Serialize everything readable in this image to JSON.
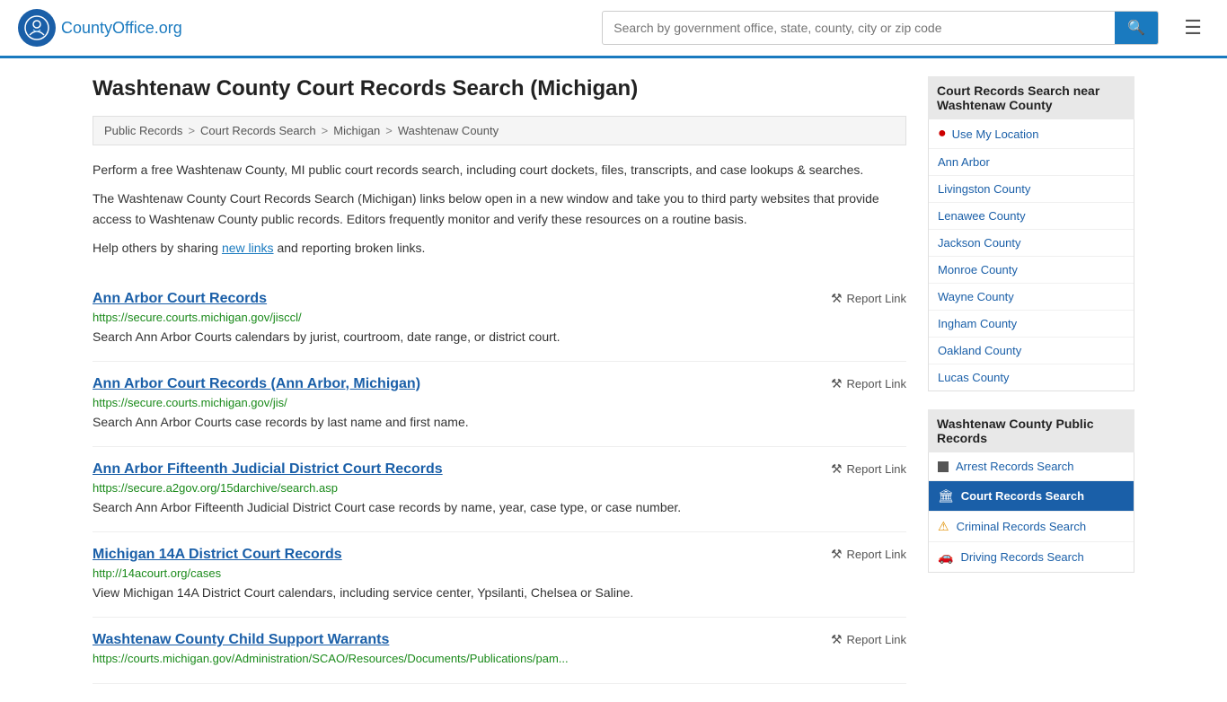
{
  "header": {
    "logo_text": "CountyOffice",
    "logo_suffix": ".org",
    "search_placeholder": "Search by government office, state, county, city or zip code",
    "search_icon": "🔍",
    "menu_icon": "☰"
  },
  "page": {
    "title": "Washtenaw County Court Records Search (Michigan)"
  },
  "breadcrumb": {
    "items": [
      {
        "label": "Public Records",
        "href": "#"
      },
      {
        "label": "Court Records Search",
        "href": "#"
      },
      {
        "label": "Michigan",
        "href": "#"
      },
      {
        "label": "Washtenaw County",
        "href": "#"
      }
    ]
  },
  "description": {
    "para1": "Perform a free Washtenaw County, MI public court records search, including court dockets, files, transcripts, and case lookups & searches.",
    "para2": "The Washtenaw County Court Records Search (Michigan) links below open in a new window and take you to third party websites that provide access to Washtenaw County public records. Editors frequently monitor and verify these resources on a routine basis.",
    "para3_before": "Help others by sharing ",
    "para3_link": "new links",
    "para3_after": " and reporting broken links."
  },
  "results": [
    {
      "title": "Ann Arbor Court Records",
      "url": "https://secure.courts.michigan.gov/jisccl/",
      "description": "Search Ann Arbor Courts calendars by jurist, courtroom, date range, or district court.",
      "report_label": "Report Link"
    },
    {
      "title": "Ann Arbor Court Records (Ann Arbor, Michigan)",
      "url": "https://secure.courts.michigan.gov/jis/",
      "description": "Search Ann Arbor Courts case records by last name and first name.",
      "report_label": "Report Link"
    },
    {
      "title": "Ann Arbor Fifteenth Judicial District Court Records",
      "url": "https://secure.a2gov.org/15darchive/search.asp",
      "description": "Search Ann Arbor Fifteenth Judicial District Court case records by name, year, case type, or case number.",
      "report_label": "Report Link"
    },
    {
      "title": "Michigan 14A District Court Records",
      "url": "http://14acourt.org/cases",
      "description": "View Michigan 14A District Court calendars, including service center, Ypsilanti, Chelsea or Saline.",
      "report_label": "Report Link"
    },
    {
      "title": "Washtenaw County Child Support Warrants",
      "url": "https://courts.michigan.gov/Administration/SCAO/Resources/Documents/Publications/pam...",
      "description": "",
      "report_label": "Report Link"
    }
  ],
  "sidebar": {
    "nearby_title": "Court Records Search near Washtenaw County",
    "use_my_location": "Use My Location",
    "nearby_links": [
      {
        "label": "Ann Arbor"
      },
      {
        "label": "Livingston County"
      },
      {
        "label": "Lenawee County"
      },
      {
        "label": "Jackson County"
      },
      {
        "label": "Monroe County"
      },
      {
        "label": "Wayne County"
      },
      {
        "label": "Ingham County"
      },
      {
        "label": "Oakland County"
      },
      {
        "label": "Lucas County"
      }
    ],
    "public_records_title": "Washtenaw County Public Records",
    "public_records_links": [
      {
        "label": "Arrest Records Search",
        "active": false,
        "icon": "square"
      },
      {
        "label": "Court Records Search",
        "active": true,
        "icon": "building"
      },
      {
        "label": "Criminal Records Search",
        "active": false,
        "icon": "warning"
      },
      {
        "label": "Driving Records Search",
        "active": false,
        "icon": "car"
      }
    ]
  }
}
